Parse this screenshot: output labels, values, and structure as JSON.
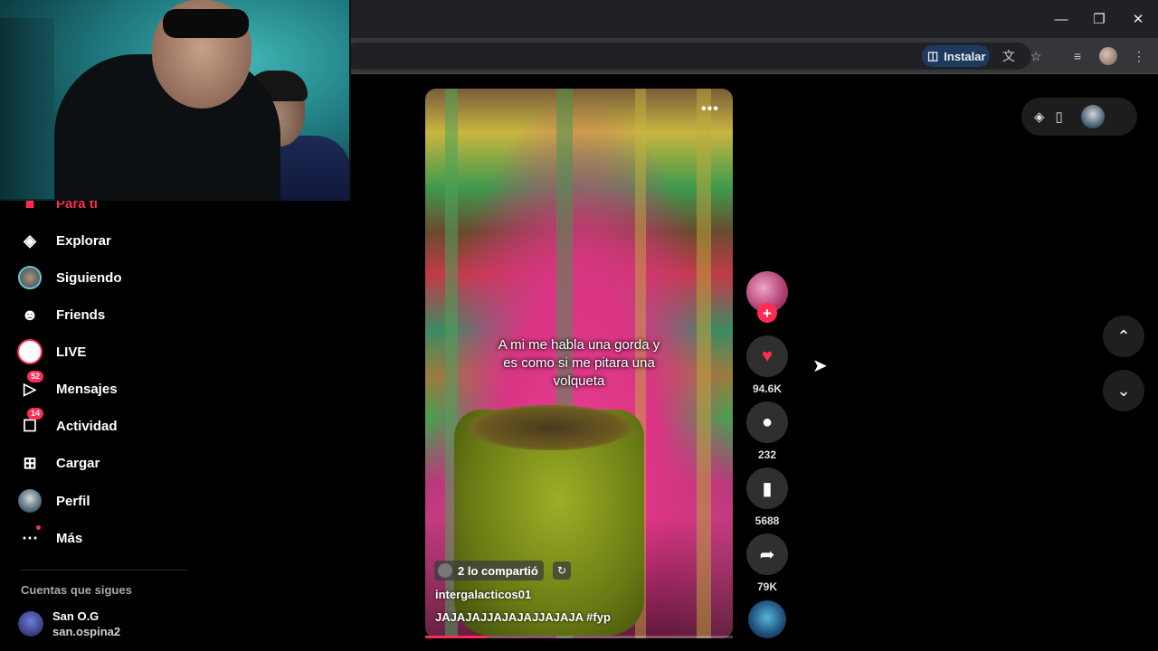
{
  "browser": {
    "install_label": "Instalar",
    "icons": [
      "install-icon",
      "translate-icon",
      "star-icon",
      "reading-list-icon",
      "profile-icon",
      "kebab-menu-icon"
    ],
    "window_controls": [
      "minimize",
      "restore",
      "close"
    ]
  },
  "sidebar": {
    "items": [
      {
        "label": "Para ti",
        "icon": "home-icon",
        "active": true
      },
      {
        "label": "Explorar",
        "icon": "compass-icon"
      },
      {
        "label": "Siguiendo",
        "icon": "following-avatar-icon"
      },
      {
        "label": "Friends",
        "icon": "friends-icon"
      },
      {
        "label": "LIVE",
        "icon": "live-icon"
      },
      {
        "label": "Mensajes",
        "icon": "messages-icon",
        "badge": "52"
      },
      {
        "label": "Actividad",
        "icon": "activity-icon",
        "badge": "14"
      },
      {
        "label": "Cargar",
        "icon": "upload-icon"
      },
      {
        "label": "Perfil",
        "icon": "profile-avatar-icon"
      },
      {
        "label": "Más",
        "icon": "more-icon"
      }
    ],
    "following_title": "Cuentas que sigues",
    "account": {
      "name": "San O.G",
      "handle": "san.ospina2"
    }
  },
  "video": {
    "caption": "A mi me habla una gorda y\nes como si me pitara una\nvolqueta",
    "shared_label": "2 lo compartió",
    "author": "intergalacticos01",
    "description": "JAJAJAJJAJAJAJJAJAJA #fyp",
    "progress": 0.2
  },
  "actions": {
    "likes": "94.6K",
    "comments": "232",
    "saves": "5688",
    "shares": "79K"
  },
  "colors": {
    "accent": "#fe2c55",
    "background": "#000000"
  }
}
